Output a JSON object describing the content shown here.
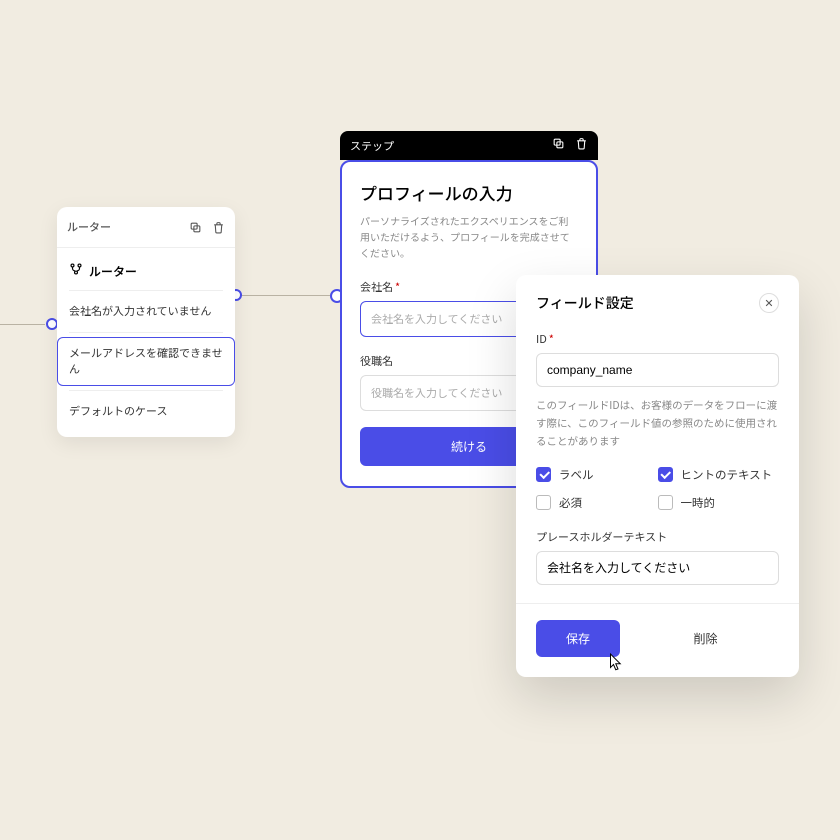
{
  "router": {
    "header": "ルーター",
    "section_label": "ルーター",
    "items": [
      "会社名が入力されていません",
      "メールアドレスを確認できません",
      "デフォルトのケース"
    ]
  },
  "step": {
    "header": "ステップ",
    "title": "プロフィールの入力",
    "description": "パーソナライズされたエクスペリエンスをご利用いただけるよう、プロフィールを完成させてください。",
    "field1_label": "会社名",
    "field1_required_mark": "*",
    "field1_placeholder": "会社名を入力してください",
    "field2_label": "役職名",
    "field2_placeholder": "役職名を入力してください",
    "continue": "続ける"
  },
  "modal": {
    "title": "フィールド設定",
    "id_label": "ID",
    "id_required_mark": "*",
    "id_value": "company_name",
    "id_help": "このフィールドIDは、お客様のデータをフローに渡す際に、このフィールド値の参照のために使用されることがあります",
    "checks": {
      "label": "ラベル",
      "hint": "ヒントのテキスト",
      "required": "必須",
      "transient": "一時的"
    },
    "placeholder_section": "プレースホルダーテキスト",
    "placeholder_value": "会社名を入力してください",
    "save": "保存",
    "delete": "削除"
  }
}
